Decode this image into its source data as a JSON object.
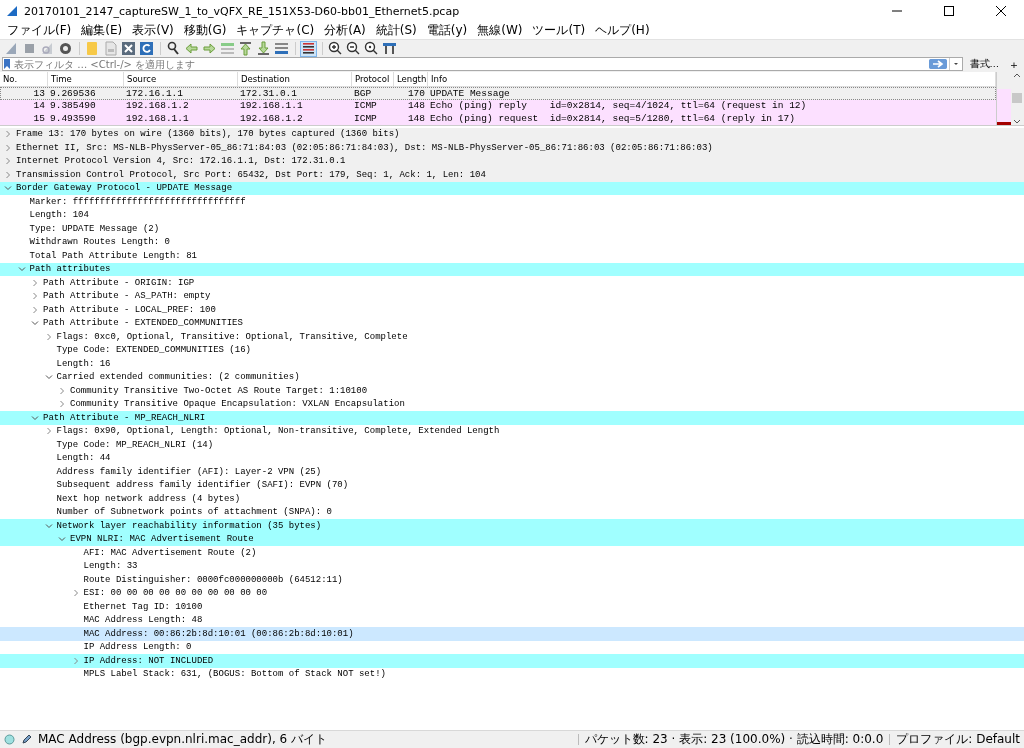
{
  "window": {
    "title": "20170101_2147_captureSW_1_to_vQFX_RE_151X53-D60-bb01_Ethernet5.pcap"
  },
  "menu": [
    "ファイル(F)",
    "編集(E)",
    "表示(V)",
    "移動(G)",
    "キャプチャ(C)",
    "分析(A)",
    "統計(S)",
    "電話(y)",
    "無線(W)",
    "ツール(T)",
    "ヘルプ(H)"
  ],
  "toolbar": [
    [
      {
        "kind": "start",
        "pressed": false
      },
      {
        "kind": "stop",
        "pressed": false
      },
      {
        "kind": "restart",
        "pressed": false
      },
      {
        "kind": "options",
        "pressed": false
      }
    ],
    [
      {
        "kind": "open",
        "pressed": false
      },
      {
        "kind": "save",
        "pressed": false
      },
      {
        "kind": "close",
        "pressed": false
      },
      {
        "kind": "reload",
        "pressed": false
      }
    ],
    [
      {
        "kind": "find",
        "pressed": false
      },
      {
        "kind": "back",
        "pressed": false
      },
      {
        "kind": "forward",
        "pressed": false
      },
      {
        "kind": "goto",
        "pressed": false
      },
      {
        "kind": "first",
        "pressed": false
      },
      {
        "kind": "last",
        "pressed": false
      },
      {
        "kind": "autoscroll",
        "pressed": false
      }
    ],
    [
      {
        "kind": "colorize",
        "pressed": true
      }
    ],
    [
      {
        "kind": "zoom_in",
        "pressed": false
      },
      {
        "kind": "zoom_out",
        "pressed": false
      },
      {
        "kind": "zoom_reset",
        "pressed": false
      },
      {
        "kind": "resize",
        "pressed": false
      }
    ]
  ],
  "filter": {
    "placeholder": "表示フィルタ … <Ctrl-/> を適用します",
    "format_button": "書式…",
    "add_button": "+"
  },
  "packet_list": {
    "columns": [
      "No.",
      "Time",
      "Source",
      "Destination",
      "Protocol",
      "Length",
      "Info"
    ],
    "rows": [
      {
        "cells": [
          "13",
          "9.269536",
          "172.16.1.1",
          "172.31.0.1",
          "BGP",
          "170",
          "UPDATE Message"
        ],
        "selected": true,
        "color": "#f0f0f0"
      },
      {
        "cells": [
          "14",
          "9.385490",
          "192.168.1.2",
          "192.168.1.1",
          "ICMP",
          "148",
          "Echo (ping) reply    id=0x2814, seq=4/1024, ttl=64 (request in 12)"
        ],
        "selected": false,
        "color": "#fce0ff"
      },
      {
        "cells": [
          "15",
          "9.493590",
          "192.168.1.1",
          "192.168.1.2",
          "ICMP",
          "148",
          "Echo (ping) request  id=0x2814, seq=5/1280, ttl=64 (reply in 17)"
        ],
        "selected": false,
        "color": "#fce0ff"
      }
    ]
  },
  "details": [
    {
      "text": "Frame 13: 170 bytes on wire (1360 bits), 170 bytes captured (1360 bits)",
      "expanded": false,
      "highlighted": false,
      "selected": false
    },
    {
      "text": "Ethernet II, Src: MS-NLB-PhysServer-05_86:71:84:03 (02:05:86:71:84:03), Dst: MS-NLB-PhysServer-05_86:71:86:03 (02:05:86:71:86:03)",
      "expanded": false,
      "highlighted": false,
      "selected": false
    },
    {
      "text": "Internet Protocol Version 4, Src: 172.16.1.1, Dst: 172.31.0.1",
      "expanded": false,
      "highlighted": false,
      "selected": false
    },
    {
      "text": "Transmission Control Protocol, Src Port: 65432, Dst Port: 179, Seq: 1, Ack: 1, Len: 104",
      "expanded": false,
      "highlighted": false,
      "selected": false
    },
    {
      "text": "Border Gateway Protocol - UPDATE Message",
      "expanded": true,
      "highlighted": true,
      "selected": false,
      "children": [
        {
          "text": "Marker: ffffffffffffffffffffffffffffffff",
          "highlighted": false,
          "selected": false
        },
        {
          "text": "Length: 104",
          "highlighted": false,
          "selected": false
        },
        {
          "text": "Type: UPDATE Message (2)",
          "highlighted": false,
          "selected": false
        },
        {
          "text": "Withdrawn Routes Length: 0",
          "highlighted": false,
          "selected": false
        },
        {
          "text": "Total Path Attribute Length: 81",
          "highlighted": false,
          "selected": false
        },
        {
          "text": "Path attributes",
          "expanded": true,
          "highlighted": true,
          "selected": false,
          "children": [
            {
              "text": "Path Attribute - ORIGIN: IGP",
              "expanded": false,
              "highlighted": false,
              "selected": false
            },
            {
              "text": "Path Attribute - AS_PATH: empty",
              "expanded": false,
              "highlighted": false,
              "selected": false
            },
            {
              "text": "Path Attribute - LOCAL_PREF: 100",
              "expanded": false,
              "highlighted": false,
              "selected": false
            },
            {
              "text": "Path Attribute - EXTENDED_COMMUNITIES",
              "expanded": true,
              "highlighted": false,
              "selected": false,
              "children": [
                {
                  "text": "Flags: 0xc0, Optional, Transitive: Optional, Transitive, Complete",
                  "expanded": false,
                  "highlighted": false,
                  "selected": false
                },
                {
                  "text": "Type Code: EXTENDED_COMMUNITIES (16)",
                  "highlighted": false,
                  "selected": false
                },
                {
                  "text": "Length: 16",
                  "highlighted": false,
                  "selected": false
                },
                {
                  "text": "Carried extended communities: (2 communities)",
                  "expanded": true,
                  "highlighted": false,
                  "selected": false,
                  "children": [
                    {
                      "text": "Community Transitive Two-Octet AS Route Target: 1:10100",
                      "expanded": false,
                      "highlighted": false,
                      "selected": false
                    },
                    {
                      "text": "Community Transitive Opaque Encapsulation: VXLAN Encapsulation",
                      "expanded": false,
                      "highlighted": false,
                      "selected": false
                    }
                  ]
                }
              ]
            },
            {
              "text": "Path Attribute - MP_REACH_NLRI",
              "expanded": true,
              "highlighted": true,
              "selected": false,
              "children": [
                {
                  "text": "Flags: 0x90, Optional, Length: Optional, Non-transitive, Complete, Extended Length",
                  "expanded": false,
                  "highlighted": false,
                  "selected": false
                },
                {
                  "text": "Type Code: MP_REACH_NLRI (14)",
                  "highlighted": false,
                  "selected": false
                },
                {
                  "text": "Length: 44",
                  "highlighted": false,
                  "selected": false
                },
                {
                  "text": "Address family identifier (AFI): Layer-2 VPN (25)",
                  "highlighted": false,
                  "selected": false
                },
                {
                  "text": "Subsequent address family identifier (SAFI): EVPN (70)",
                  "highlighted": false,
                  "selected": false
                },
                {
                  "text": "Next hop network address (4 bytes)",
                  "highlighted": false,
                  "selected": false
                },
                {
                  "text": "Number of Subnetwork points of attachment (SNPA): 0",
                  "highlighted": false,
                  "selected": false
                },
                {
                  "text": "Network layer reachability information (35 bytes)",
                  "expanded": true,
                  "highlighted": true,
                  "selected": false,
                  "children": [
                    {
                      "text": "EVPN NLRI: MAC Advertisement Route",
                      "expanded": true,
                      "highlighted": true,
                      "selected": false,
                      "children": [
                        {
                          "text": "AFI: MAC Advertisement Route (2)",
                          "highlighted": false,
                          "selected": false
                        },
                        {
                          "text": "Length: 33",
                          "highlighted": false,
                          "selected": false
                        },
                        {
                          "text": "Route Distinguisher: 0000fc000000000b (64512:11)",
                          "highlighted": false,
                          "selected": false
                        },
                        {
                          "text": "ESI: 00 00 00 00 00 00 00 00 00 00",
                          "expanded": false,
                          "highlighted": false,
                          "selected": false
                        },
                        {
                          "text": "Ethernet Tag ID: 10100",
                          "highlighted": false,
                          "selected": false
                        },
                        {
                          "text": "MAC Address Length: 48",
                          "highlighted": false,
                          "selected": false
                        },
                        {
                          "text": "MAC Address: 00:86:2b:8d:10:01 (00:86:2b:8d:10:01)",
                          "highlighted": false,
                          "selected": true
                        },
                        {
                          "text": "IP Address Length: 0",
                          "highlighted": false,
                          "selected": false
                        },
                        {
                          "text": "IP Address: NOT INCLUDED",
                          "expanded": false,
                          "highlighted": true,
                          "selected": false
                        },
                        {
                          "text": "MPLS Label Stack: 631, (BOGUS: Bottom of Stack NOT set!)",
                          "highlighted": false,
                          "selected": false
                        }
                      ]
                    }
                  ]
                }
              ]
            }
          ]
        }
      ]
    }
  ],
  "status_bar": {
    "field": "MAC Address (bgp.evpn.nlri.mac_addr), 6 バイト",
    "packets": "パケット数: 23 · 表示: 23 (100.0%) · 読込時間: 0:0.0",
    "profile": "プロファイル: Default"
  }
}
